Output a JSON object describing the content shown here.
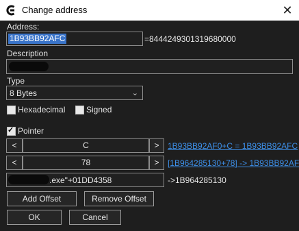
{
  "window": {
    "title": "Change address",
    "close_glyph": "✕",
    "icon": "cheat-engine-icon"
  },
  "address": {
    "label": "Address:",
    "value": "1B93BB92AFC",
    "resolved": "=8444249301319680000"
  },
  "description": {
    "label": "Description"
  },
  "type": {
    "label": "Type",
    "selected": "8 Bytes",
    "chevron": "⌄"
  },
  "options": {
    "hexadecimal_label": "Hexadecimal",
    "hexadecimal_checked": false,
    "signed_label": "Signed",
    "signed_checked": false,
    "pointer_label": "Pointer",
    "pointer_checked": true
  },
  "pointer": {
    "offsets": [
      {
        "dec": "<",
        "value": "C",
        "inc": ">",
        "result": "1B93BB92AF0+C = 1B93BB92AFC"
      },
      {
        "dec": "<",
        "value": "78",
        "inc": ">",
        "result": "[1B964285130+78] -> 1B93BB92AF0"
      }
    ],
    "base_suffix": ".exe\"+01DD4358",
    "base_result": "->1B964285130"
  },
  "buttons": {
    "add_offset": "Add Offset",
    "remove_offset": "Remove Offset",
    "ok": "OK",
    "cancel": "Cancel"
  }
}
